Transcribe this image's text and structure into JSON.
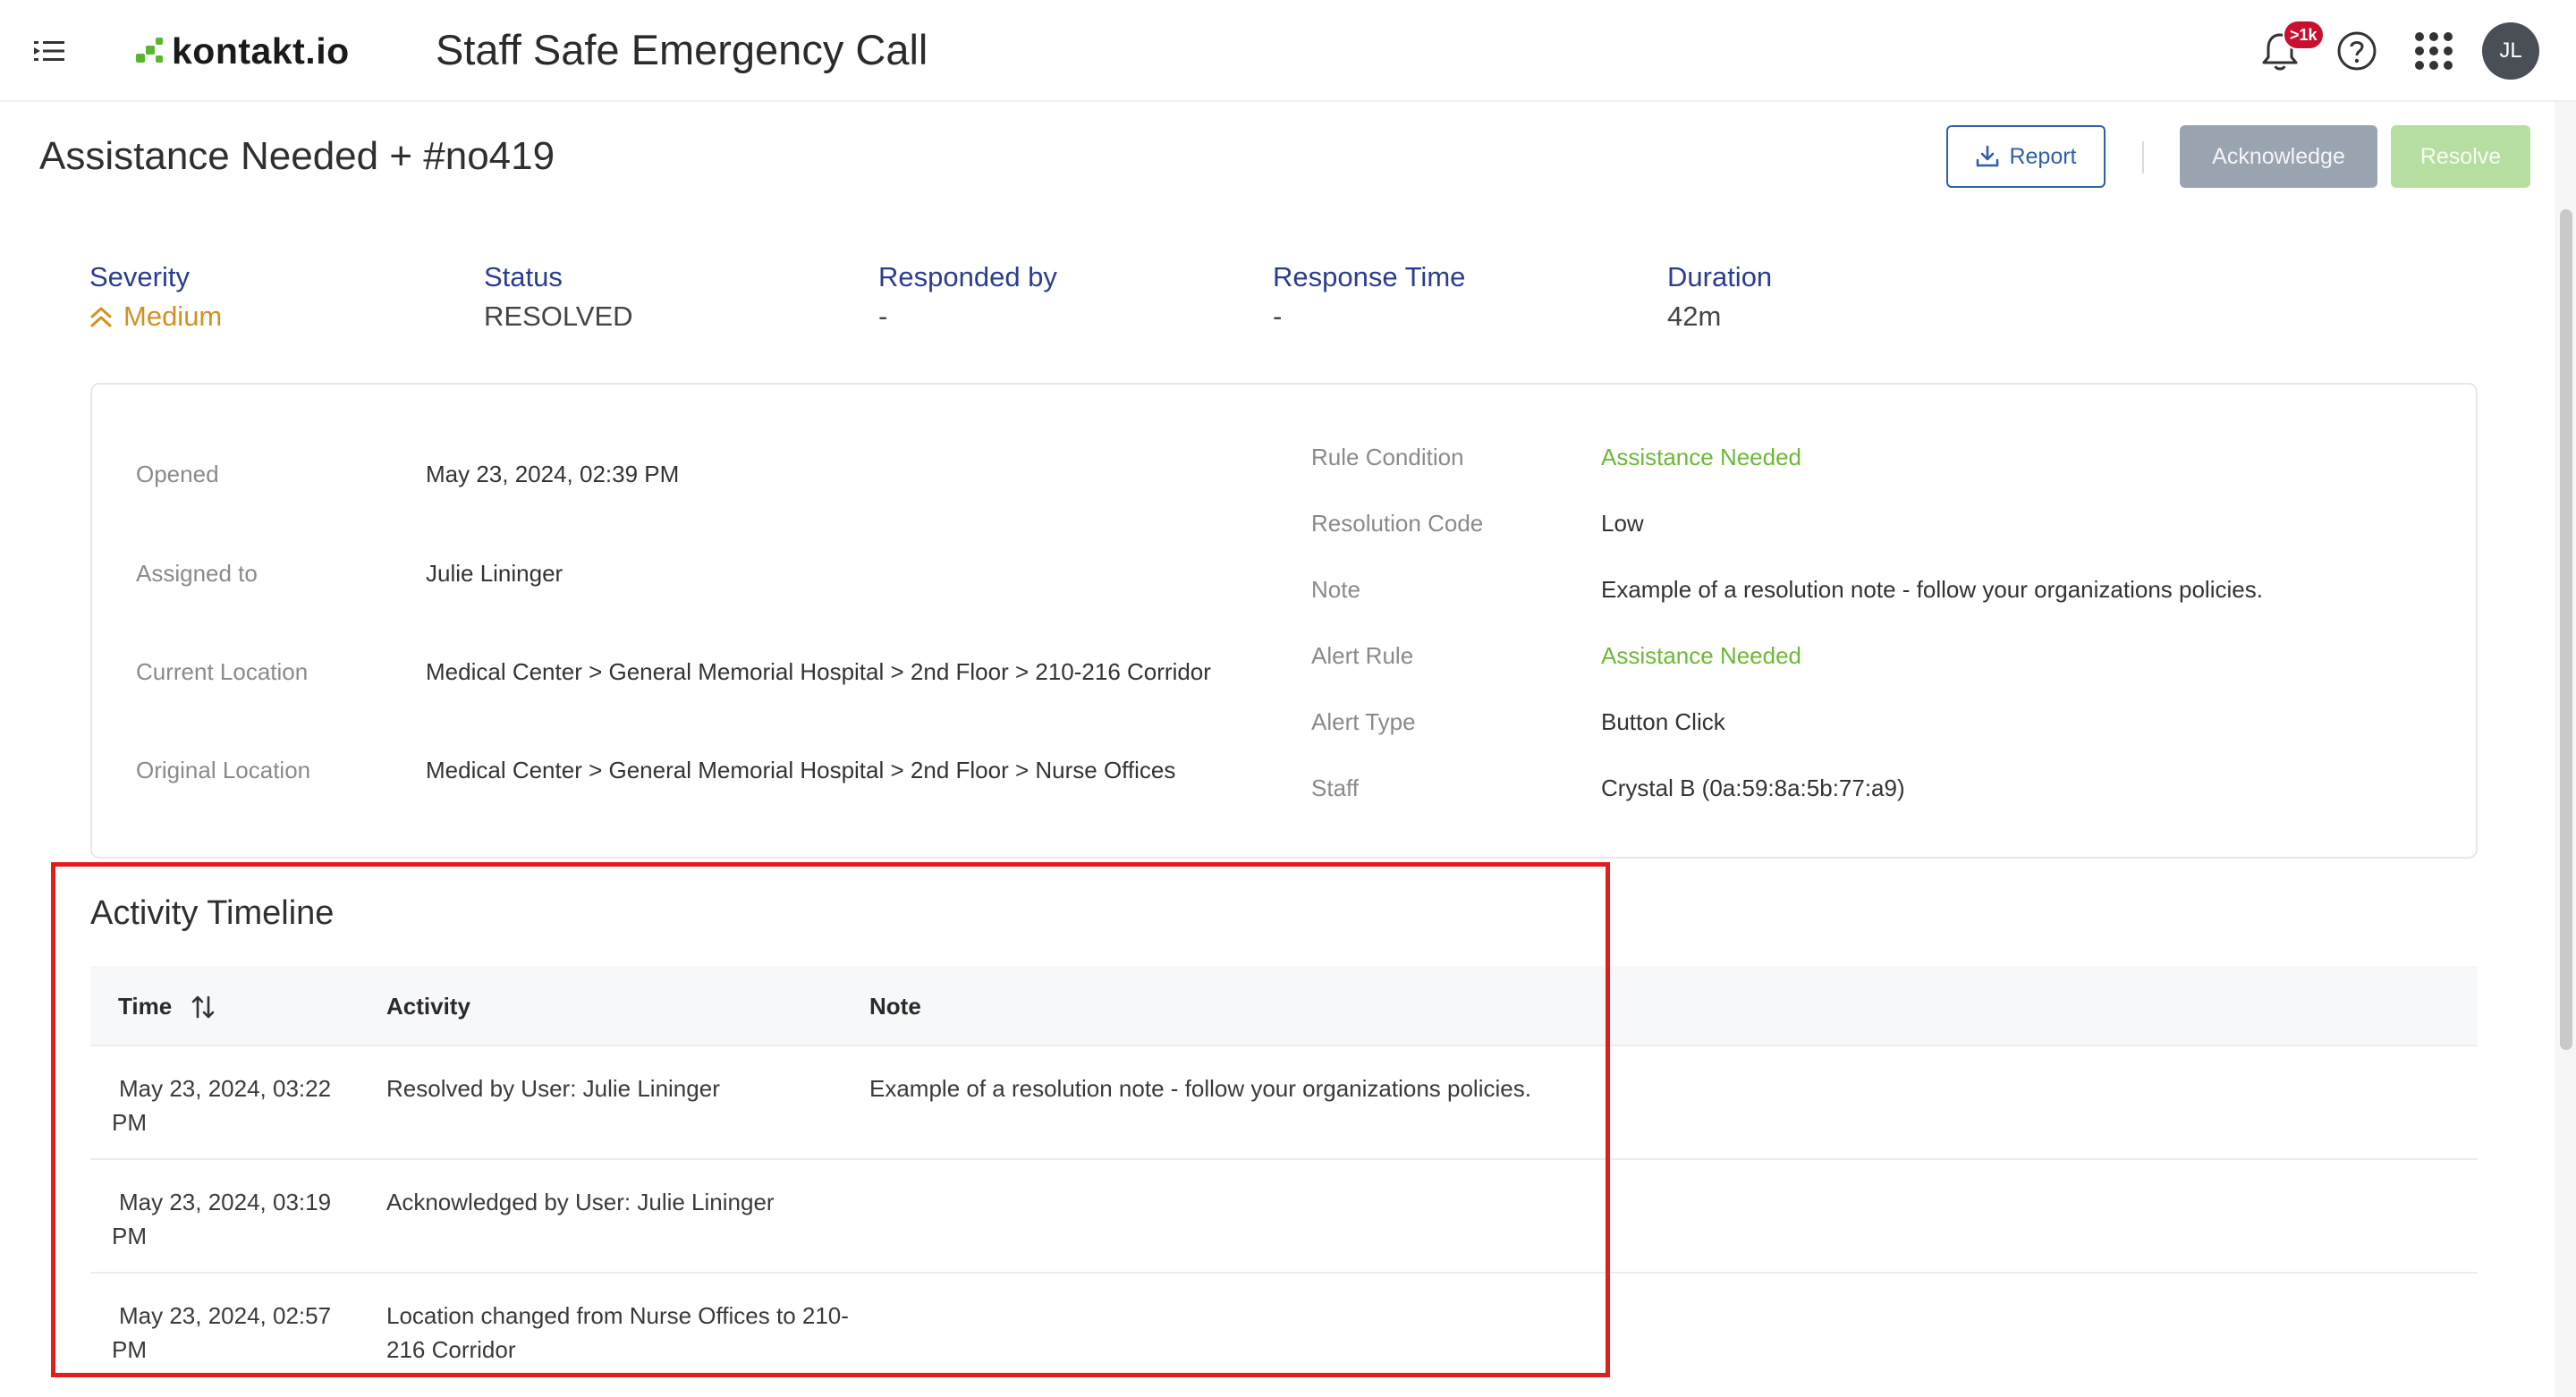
{
  "topbar": {
    "brand": "kontakt.io",
    "app_title": "Staff Safe Emergency Call",
    "notification_badge": ">1k",
    "avatar_initials": "JL",
    "icons": [
      "menu-toggle-icon",
      "bell-icon",
      "help-icon",
      "apps-grid-icon"
    ]
  },
  "header": {
    "title": "Assistance Needed + #no419",
    "report_label": "Report",
    "acknowledge_label": "Acknowledge",
    "resolve_label": "Resolve"
  },
  "summary": {
    "severity_label": "Severity",
    "severity_value": "Medium",
    "status_label": "Status",
    "status_value": "RESOLVED",
    "responded_label": "Responded by",
    "responded_value": "-",
    "response_time_label": "Response Time",
    "response_time_value": "-",
    "duration_label": "Duration",
    "duration_value": "42m"
  },
  "details": {
    "left": [
      {
        "key": "Opened",
        "value": "May 23, 2024, 02:39 PM"
      },
      {
        "key": "Assigned to",
        "value": "Julie Lininger"
      },
      {
        "key": "Current Location",
        "value": "Medical Center > General Memorial Hospital > 2nd Floor > 210-216 Corridor"
      },
      {
        "key": "Original Location",
        "value": "Medical Center > General Memorial Hospital > 2nd Floor > Nurse Offices"
      }
    ],
    "right": [
      {
        "key": "Rule Condition",
        "value": "Assistance Needed"
      },
      {
        "key": "Resolution Code",
        "value": "Low"
      },
      {
        "key": "Note",
        "value": "Example of a resolution note - follow your organizations policies."
      },
      {
        "key": "Alert Rule",
        "value": "Assistance Needed"
      },
      {
        "key": "Alert Type",
        "value": "Button Click"
      },
      {
        "key": "Staff",
        "value": "Crystal B (0a:59:8a:5b:77:a9)"
      }
    ]
  },
  "timeline": {
    "title": "Activity Timeline",
    "columns": {
      "time": "Time",
      "activity": "Activity",
      "note": "Note"
    },
    "rows": [
      {
        "time": "May 23, 2024, 03:22 PM",
        "activity": "Resolved by User: Julie Lininger",
        "note": "Example of a resolution note - follow your organizations policies."
      },
      {
        "time": "May 23, 2024, 03:19 PM",
        "activity": "Acknowledged by User: Julie Lininger",
        "note": ""
      },
      {
        "time": "May 23, 2024, 02:57 PM",
        "activity": "Location changed from Nurse Offices to 210-216 Corridor",
        "note": ""
      }
    ]
  },
  "colors": {
    "accent_blue": "#2a3d8f",
    "severity_medium": "#d39021",
    "link_green": "#6cb838",
    "highlight_red": "#e01e1e"
  }
}
